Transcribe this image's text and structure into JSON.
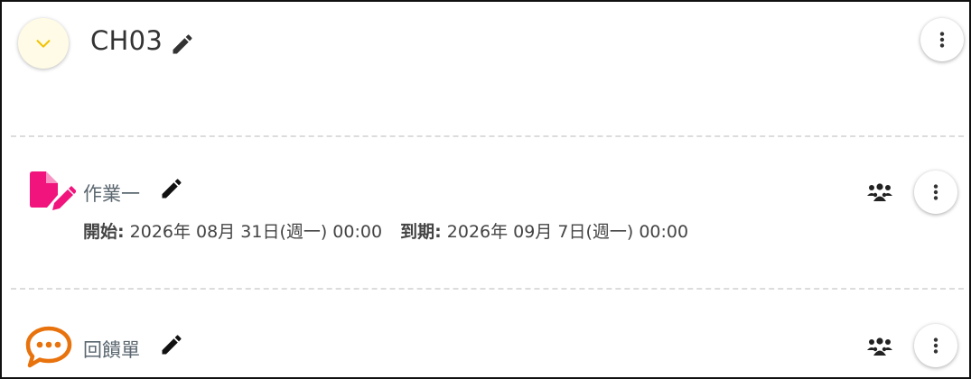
{
  "section": {
    "title": "CH03",
    "collapse_icon": "chevron-down-icon",
    "edit_icon": "pencil-icon",
    "more_icon": "more-vertical-icon"
  },
  "items": [
    {
      "type_icon": "assignment-edit-icon",
      "title": "作業一",
      "start_label": "開始:",
      "start_value": "2026年 08月 31日(週一) 00:00",
      "due_label": "到期:",
      "due_value": "2026年 09月 7日(週一) 00:00",
      "group_icon": "group-icon",
      "more_icon": "more-vertical-icon",
      "accent": "#f0147c"
    },
    {
      "type_icon": "chat-bubble-icon",
      "title": "回饋單",
      "group_icon": "group-icon",
      "more_icon": "more-vertical-icon",
      "accent": "#e8720c"
    }
  ],
  "colors": {
    "collapse_bg": "#fffbe6",
    "chevron": "#f2c200",
    "title_text": "#333333",
    "item_text": "#5b6770",
    "divider": "#dcdcdc"
  }
}
